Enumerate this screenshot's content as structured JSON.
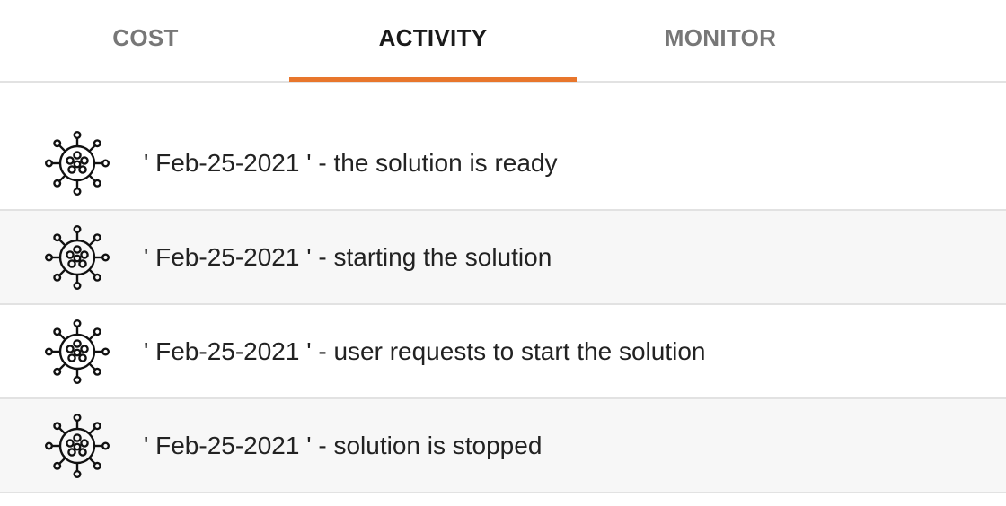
{
  "tabs": [
    {
      "label": "COST",
      "active": false
    },
    {
      "label": "ACTIVITY",
      "active": true
    },
    {
      "label": "MONITOR",
      "active": false
    }
  ],
  "accent_color": "#e8762c",
  "activity": {
    "icon": "virus-icon",
    "items": [
      {
        "text": "' Feb-25-2021 ' - the solution is ready"
      },
      {
        "text": "' Feb-25-2021 ' - starting the solution"
      },
      {
        "text": "' Feb-25-2021 ' - user requests to start the solution"
      },
      {
        "text": "' Feb-25-2021 ' - solution is stopped"
      }
    ]
  }
}
